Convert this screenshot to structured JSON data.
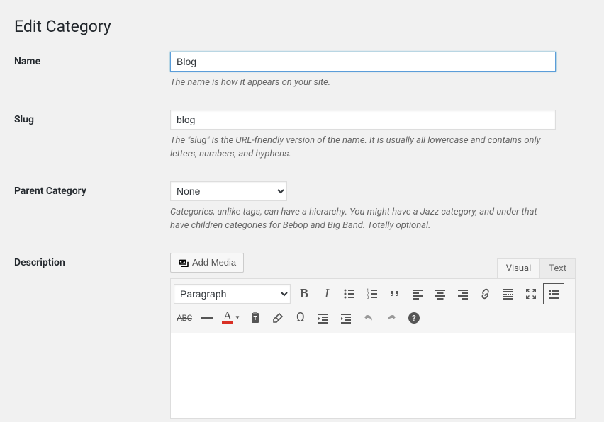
{
  "page": {
    "title": "Edit Category"
  },
  "fields": {
    "name": {
      "label": "Name",
      "value": "Blog",
      "help": "The name is how it appears on your site."
    },
    "slug": {
      "label": "Slug",
      "value": "blog",
      "help": "The \"slug\" is the URL-friendly version of the name. It is usually all lowercase and contains only letters, numbers, and hyphens."
    },
    "parent": {
      "label": "Parent Category",
      "selected": "None",
      "help": "Categories, unlike tags, can have a hierarchy. You might have a Jazz category, and under that have children categories for Bebop and Big Band. Totally optional."
    },
    "description": {
      "label": "Description"
    }
  },
  "editor": {
    "add_media_label": "Add Media",
    "tabs": {
      "visual": "Visual",
      "text": "Text"
    },
    "format_selected": "Paragraph"
  }
}
